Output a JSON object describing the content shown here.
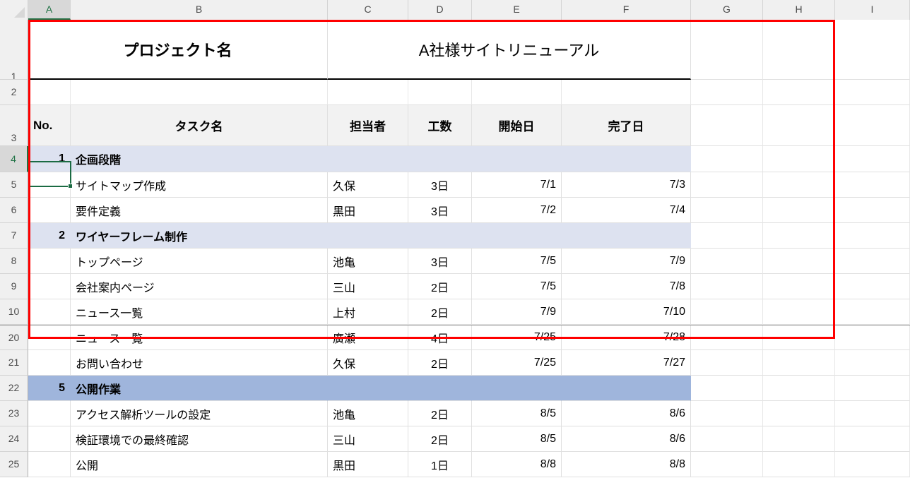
{
  "spreadsheet": {
    "columns": [
      "A",
      "B",
      "C",
      "D",
      "E",
      "F",
      "G",
      "H",
      "I"
    ],
    "active_cell": "A4",
    "active_column": "A",
    "active_row": "4",
    "row_numbers": [
      "1",
      "2",
      "3",
      "4",
      "5",
      "6",
      "7",
      "8",
      "9",
      "10",
      "20",
      "21",
      "22",
      "23",
      "24",
      "25"
    ],
    "hidden_rows_note": "11-19",
    "accent_color": "#217346",
    "annotation_color": "#ff0000",
    "section_light_color": "#dde2f0",
    "section_dark_color": "#9fb5dc",
    "header_fill_color": "#f2f2f2"
  },
  "title": {
    "label": "プロジェクト名",
    "value": "A社様サイトリニューアル"
  },
  "table_headers": {
    "no": "No.",
    "task": "タスク名",
    "assignee": "担当者",
    "effort": "工数",
    "start": "開始日",
    "end": "完了日"
  },
  "rows": [
    {
      "row": "4",
      "kind": "section",
      "shade": "light",
      "no": "1",
      "task": "企画段階",
      "assignee": "",
      "effort": "",
      "start": "",
      "end": ""
    },
    {
      "row": "5",
      "kind": "task",
      "no": "",
      "task": "サイトマップ作成",
      "assignee": "久保",
      "effort": "3日",
      "start": "7/1",
      "end": "7/3"
    },
    {
      "row": "6",
      "kind": "task",
      "no": "",
      "task": "要件定義",
      "assignee": "黒田",
      "effort": "3日",
      "start": "7/2",
      "end": "7/4"
    },
    {
      "row": "7",
      "kind": "section",
      "shade": "light",
      "no": "2",
      "task": "ワイヤーフレーム制作",
      "assignee": "",
      "effort": "",
      "start": "",
      "end": ""
    },
    {
      "row": "8",
      "kind": "task",
      "no": "",
      "task": "トップページ",
      "assignee": "池亀",
      "effort": "3日",
      "start": "7/5",
      "end": "7/9"
    },
    {
      "row": "9",
      "kind": "task",
      "no": "",
      "task": "会社案内ページ",
      "assignee": "三山",
      "effort": "2日",
      "start": "7/5",
      "end": "7/8"
    },
    {
      "row": "10",
      "kind": "task",
      "no": "",
      "task": "ニュース一覧",
      "assignee": "上村",
      "effort": "2日",
      "start": "7/9",
      "end": "7/10"
    },
    {
      "row": "20",
      "kind": "task",
      "no": "",
      "task": "ニュース一覧",
      "assignee": "廣瀬",
      "effort": "4日",
      "start": "7/25",
      "end": "7/28"
    },
    {
      "row": "21",
      "kind": "task",
      "no": "",
      "task": "お問い合わせ",
      "assignee": "久保",
      "effort": "2日",
      "start": "7/25",
      "end": "7/27"
    },
    {
      "row": "22",
      "kind": "section",
      "shade": "dark",
      "no": "5",
      "task": "公開作業",
      "assignee": "",
      "effort": "",
      "start": "",
      "end": ""
    },
    {
      "row": "23",
      "kind": "task",
      "no": "",
      "task": "アクセス解析ツールの設定",
      "assignee": "池亀",
      "effort": "2日",
      "start": "8/5",
      "end": "8/6"
    },
    {
      "row": "24",
      "kind": "task",
      "no": "",
      "task": "検証環境での最終確認",
      "assignee": "三山",
      "effort": "2日",
      "start": "8/5",
      "end": "8/6"
    },
    {
      "row": "25",
      "kind": "task",
      "no": "",
      "task": "公開",
      "assignee": "黒田",
      "effort": "1日",
      "start": "8/8",
      "end": "8/8"
    }
  ]
}
